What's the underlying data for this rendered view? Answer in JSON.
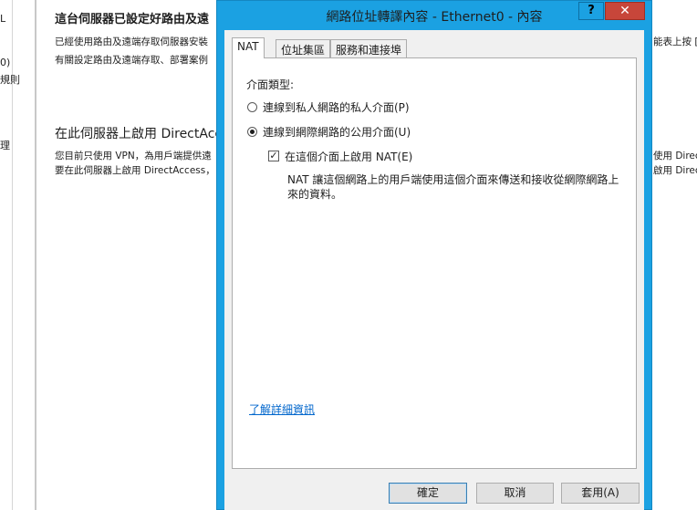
{
  "background": {
    "left_items": [
      "L",
      "0)",
      "規則",
      "理"
    ],
    "heading1": "這台伺服器已設定好路由及遠",
    "text1a": "已經使用路由及遠端存取伺服器安裝",
    "text1b": "有關設定路由及遠端存取、部署案例",
    "heading2": "在此伺服器上啟用 DirectAcc",
    "text2a": "您目前只使用 VPN，為用戶端提供遠",
    "text2b": "要在此伺服器上啟用 DirectAccess，",
    "right1": "能表上按 [I",
    "right2a": "使用 Direc",
    "right2b": "啟用 Direc"
  },
  "dialog": {
    "title": "網路位址轉譯內容 - Ethernet0 - 內容",
    "help_label": "?",
    "close_label": "✕",
    "tabs": [
      "NAT",
      "位址集區",
      "服務和連接埠"
    ],
    "interface_type_label": "介面類型:",
    "radio_private": "連線到私人網路的私人介面(P)",
    "radio_public": "連線到網際網路的公用介面(U)",
    "enable_nat": "在這個介面上啟用 NAT(E)",
    "description": "NAT 讓這個網路上的用戶端使用這個介面來傳送和接收從網際網路上來的資料。",
    "learn_more": "了解詳細資訊",
    "ok": "確定",
    "cancel": "取消",
    "apply": "套用(A)"
  }
}
